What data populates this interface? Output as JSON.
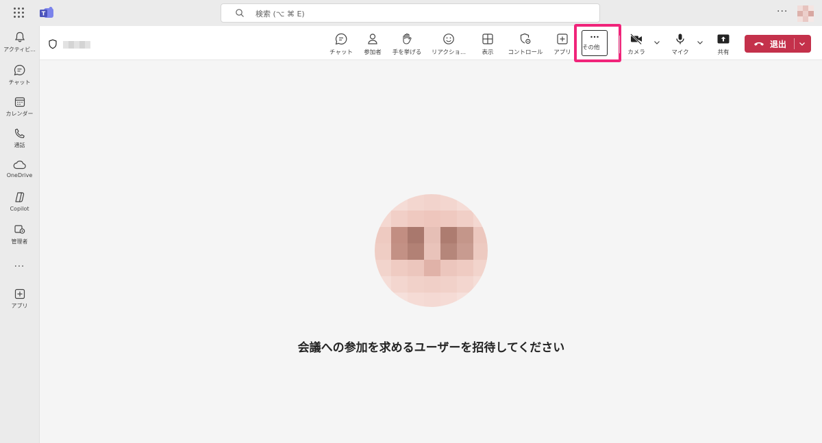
{
  "search": {
    "placeholder": "検索 (⌥ ⌘ E)"
  },
  "titlebar": {
    "more_label": "···"
  },
  "rail": {
    "items": [
      {
        "label": "アクティビ..."
      },
      {
        "label": "チャット"
      },
      {
        "label": "カレンダー"
      },
      {
        "label": "通話"
      },
      {
        "label": "OneDrive"
      },
      {
        "label": "Copilot"
      },
      {
        "label": "管理者"
      },
      {
        "label": "アプリ"
      }
    ],
    "more_label": "···"
  },
  "toolbar": {
    "chat": "チャット",
    "people": "参加者",
    "raise_hand": "手を挙げる",
    "reactions": "リアクショ...",
    "view": "表示",
    "controls": "コントロール",
    "apps": "アプリ",
    "more": "その他",
    "camera": "カメラ",
    "mic": "マイク",
    "share": "共有",
    "leave": "退出"
  },
  "stage": {
    "invite_text": "会議への参加を求めるユーザーを招待してください"
  },
  "colors": {
    "leave": "#c4314b",
    "highlight": "#f0247a",
    "teams_brand": "#5b5fc7"
  }
}
